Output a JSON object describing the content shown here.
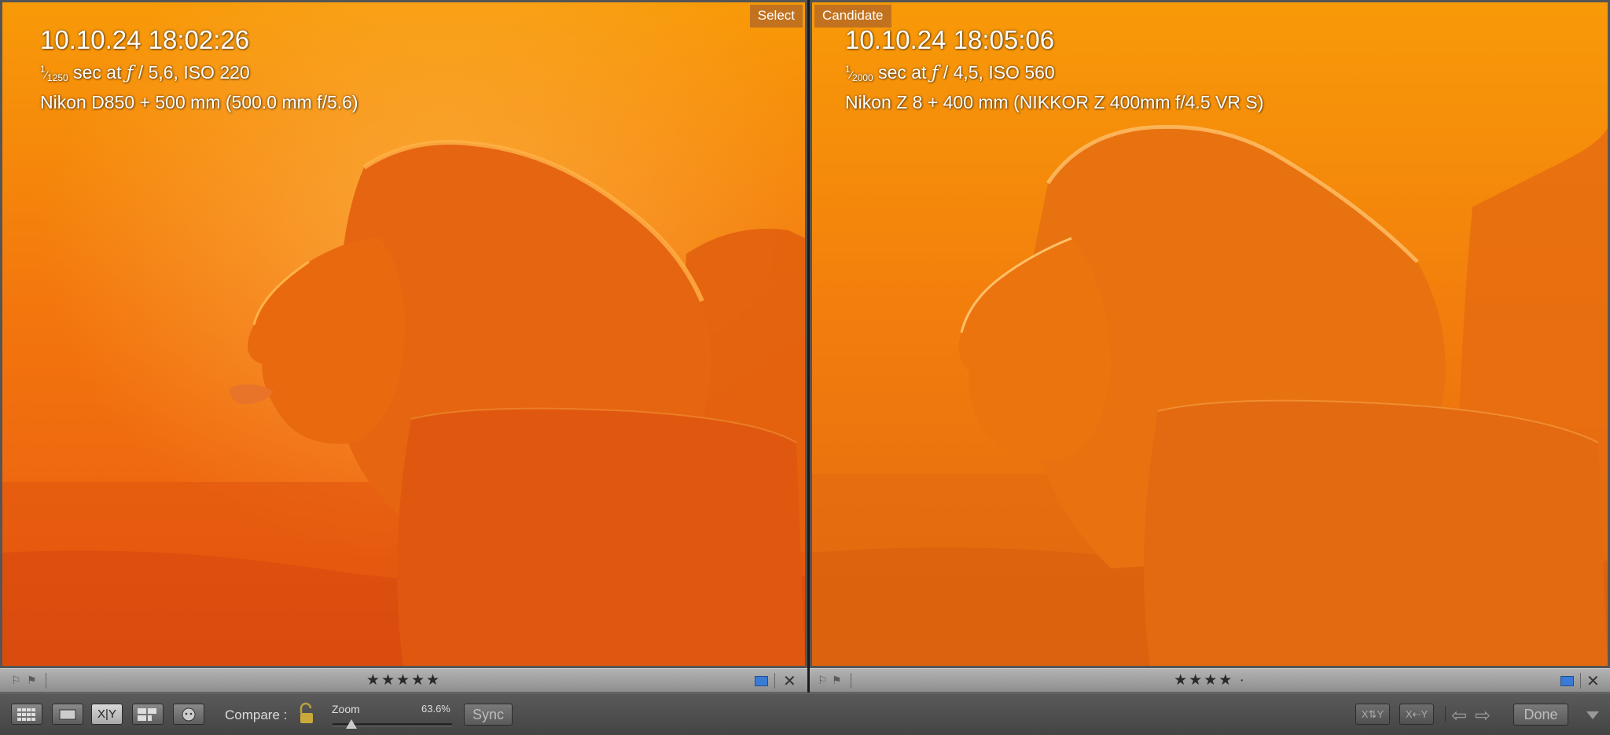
{
  "left_pane": {
    "tag": "Select",
    "datetime": "10.10.24 18:02:26",
    "shutter_numerator": "1",
    "shutter_denominator": "1250",
    "exposure_mid": " sec at ",
    "fstop_symbol": "ƒ",
    "exposure_rest": " / 5,6, ISO 220",
    "camera": "Nikon D850 + 500 mm (500.0 mm f/5.6)",
    "stars": "★★★★★"
  },
  "right_pane": {
    "tag": "Candidate",
    "datetime": "10.10.24 18:05:06",
    "shutter_numerator": "1",
    "shutter_denominator": "2000",
    "exposure_mid": " sec at ",
    "fstop_symbol": "ƒ",
    "exposure_rest": " / 4,5, ISO 560",
    "camera": "Nikon Z 8 + 400 mm (NIKKOR Z 400mm f/4.5 VR S)",
    "stars": "★★★★ ·"
  },
  "toolbar": {
    "compare_label": "Compare :",
    "zoom_label": "Zoom",
    "zoom_value": "63.6%",
    "zoom_level_percent": 63.6,
    "sync_label": "Sync",
    "done_label": "Done",
    "xy_label": "X|Y"
  },
  "colors": {
    "tag_bg": "#c2721e",
    "color_label_blue": "#3a7bd5",
    "photo_orange": "#f07a10"
  }
}
